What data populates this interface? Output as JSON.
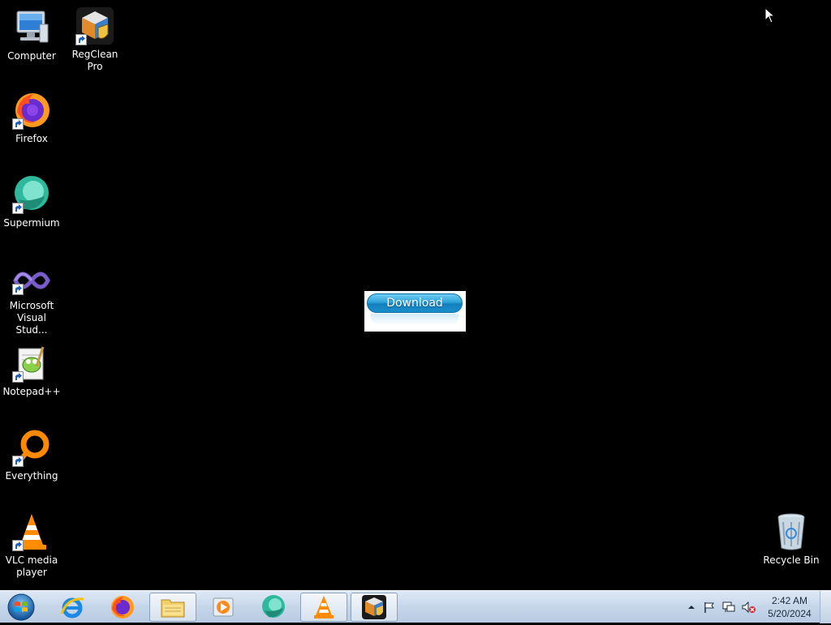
{
  "desktop": {
    "icons": [
      {
        "label": "Computer",
        "icon": "computer-icon"
      },
      {
        "label": "RegClean Pro",
        "icon": "regclean-pro-icon"
      },
      {
        "label": "Firefox",
        "icon": "firefox-icon"
      },
      {
        "label": "Supermium",
        "icon": "supermium-icon"
      },
      {
        "label": "Microsoft Visual Stud...",
        "icon": "visual-studio-icon"
      },
      {
        "label": "Notepad++",
        "icon": "notepad-plus-plus-icon"
      },
      {
        "label": "Everything",
        "icon": "everything-icon"
      },
      {
        "label": "VLC media player",
        "icon": "vlc-icon"
      },
      {
        "label": "Recycle Bin",
        "icon": "recycle-bin-icon"
      }
    ]
  },
  "popup": {
    "button_label": "Download"
  },
  "taskbar": {
    "items": [
      {
        "icon": "windows-start-icon"
      },
      {
        "icon": "internet-explorer-icon"
      },
      {
        "icon": "firefox-icon"
      },
      {
        "icon": "file-explorer-icon"
      },
      {
        "icon": "media-player-icon"
      },
      {
        "icon": "supermium-icon"
      },
      {
        "icon": "vlc-icon"
      },
      {
        "icon": "regclean-pro-icon"
      }
    ],
    "tray": {
      "icons": [
        "show-hidden-icons-icon",
        "action-center-flag-icon",
        "network-icon",
        "volume-muted-icon"
      ],
      "time": "2:42 AM",
      "date": "5/20/2024"
    }
  }
}
